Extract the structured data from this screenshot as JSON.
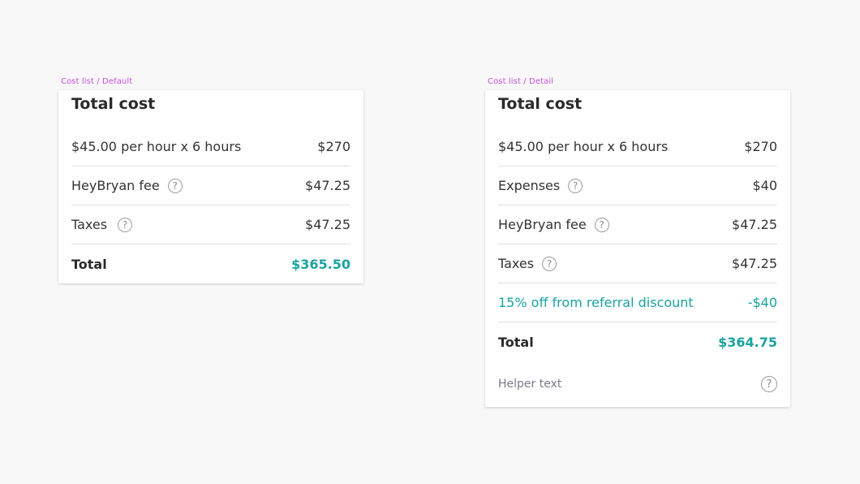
{
  "default_frame": {
    "label": "Cost list / Default",
    "title": "Total cost",
    "rows": [
      {
        "label": "$45.00 per hour x 6 hours",
        "value": "$270"
      },
      {
        "label": "HeyBryan fee",
        "value": "$47.25"
      },
      {
        "label": "Taxes",
        "value": "$47.25"
      }
    ],
    "total": {
      "label": "Total",
      "value": "$365.50"
    }
  },
  "detail_frame": {
    "label": "Cost list / Detail",
    "title": "Total cost",
    "rows": [
      {
        "label": "$45.00 per hour x 6 hours",
        "value": "$270"
      },
      {
        "label": "Expenses",
        "value": "$40"
      },
      {
        "label": "HeyBryan fee",
        "value": "$47.25"
      },
      {
        "label": "Taxes",
        "value": "$47.25"
      },
      {
        "label": "15% off from referral discount",
        "value": "-$40"
      }
    ],
    "total": {
      "label": "Total",
      "value": "$364.75"
    },
    "helper": {
      "label": "Helper text"
    }
  },
  "icons": {
    "help": "?"
  },
  "colors": {
    "accent": "#1aa3a0",
    "frame_label": "#c84fe0"
  }
}
